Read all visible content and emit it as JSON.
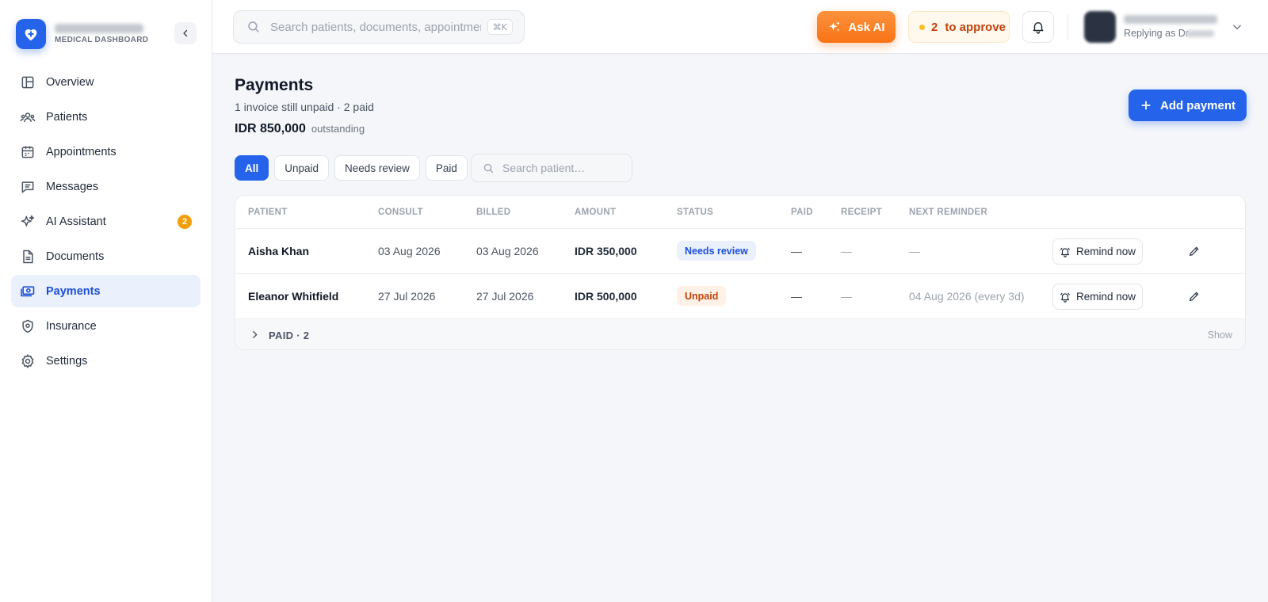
{
  "brand": {
    "subtitle": "MEDICAL DASHBOARD"
  },
  "sidebar": {
    "items": [
      {
        "label": "Overview",
        "icon": "layout-icon",
        "active": false
      },
      {
        "label": "Patients",
        "icon": "users-icon",
        "active": false
      },
      {
        "label": "Appointments",
        "icon": "calendar-icon",
        "active": false
      },
      {
        "label": "Messages",
        "icon": "message-icon",
        "active": false
      },
      {
        "label": "AI Assistant",
        "icon": "sparkles-icon",
        "active": false,
        "badge": "2"
      },
      {
        "label": "Documents",
        "icon": "document-icon",
        "active": false
      },
      {
        "label": "Payments",
        "icon": "payments-icon",
        "active": true
      },
      {
        "label": "Insurance",
        "icon": "shield-icon",
        "active": false
      },
      {
        "label": "Settings",
        "icon": "gear-icon",
        "active": false
      }
    ]
  },
  "header": {
    "search_placeholder": "Search patients, documents, appointments",
    "search_shortcut": "⌘K",
    "ask_ai_label": "Ask AI",
    "approve_count": "2",
    "approve_label": "to approve",
    "profile_subtitle": "Replying as Dr"
  },
  "page": {
    "title": "Payments",
    "subtitle": "1 invoice still unpaid · 2 paid",
    "outstanding_amount": "IDR 850,000",
    "outstanding_label": "outstanding",
    "add_button_label": "Add payment"
  },
  "filters": {
    "chips": [
      "All",
      "Unpaid",
      "Needs review",
      "Paid"
    ],
    "active": "All",
    "search_placeholder": "Search patient…"
  },
  "table": {
    "columns": [
      "PATIENT",
      "CONSULT",
      "BILLED",
      "AMOUNT",
      "STATUS",
      "PAID",
      "RECEIPT",
      "NEXT REMINDER"
    ],
    "rows": [
      {
        "patient": "Aisha Khan",
        "consult": "03 Aug 2026",
        "billed": "03 Aug 2026",
        "amount": "IDR 350,000",
        "status": "Needs review",
        "paid": "—",
        "receipt": "—",
        "next_reminder": "—",
        "action": "Remind now"
      },
      {
        "patient": "Eleanor Whitfield",
        "consult": "27 Jul 2026",
        "billed": "27 Jul 2026",
        "amount": "IDR 500,000",
        "status": "Unpaid",
        "paid": "—",
        "receipt": "—",
        "next_reminder": "04 Aug 2026 (every 3d)",
        "action": "Remind now"
      }
    ],
    "paid_group": {
      "label": "PAID · 2",
      "toggle": "Show"
    }
  },
  "colors": {
    "primary": "#2563eb",
    "accent_orange": "#f97316",
    "badge_amber": "#f59e0b",
    "review_badge_bg": "#eaf1fd",
    "unpaid_badge_bg": "#fff1e6"
  }
}
